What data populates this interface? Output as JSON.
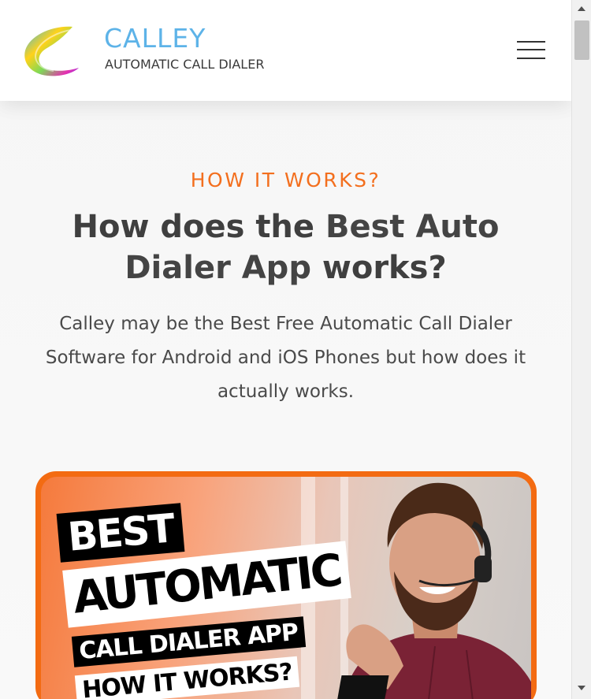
{
  "header": {
    "brand_name": "CALLEY",
    "brand_tagline": "AUTOMATIC CALL DIALER",
    "logo_icon": "calley-swirl-logo",
    "menu_icon": "hamburger-menu-icon"
  },
  "section": {
    "eyebrow": "HOW IT WORKS?",
    "headline_part1": "How does the ",
    "headline_bold1": "Best Auto Dialer App",
    "headline_part2": " works?",
    "description": "Calley may be the Best Free Automatic Call Dialer Software for Android and iOS Phones but how does it actually works."
  },
  "video": {
    "line1": "BEST",
    "line2": "AUTOMATIC",
    "line3": "CALL DIALER APP",
    "line4": "HOW IT WORKS?"
  },
  "colors": {
    "accent": "#f36f1e",
    "brand_blue": "#5db3e8",
    "text_dark": "#3f3f3f"
  }
}
